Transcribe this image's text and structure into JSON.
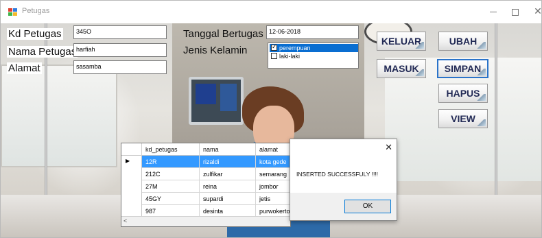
{
  "window": {
    "title": "Petugas",
    "controls": {
      "minimize_icon": "minimize-icon",
      "maximize_icon": "maximize-icon",
      "close_glyph": "✕"
    }
  },
  "form": {
    "kd_petugas": {
      "label": "Kd Petugas",
      "value": "345O"
    },
    "nama_petugas": {
      "label": "Nama Petugas",
      "value": "harfiah"
    },
    "alamat": {
      "label": "Alamat",
      "value": "sasamba"
    },
    "tanggal_bertugas": {
      "label": "Tanggal Bertugas",
      "value": "12-06-2018"
    },
    "jenis_kelamin": {
      "label": "Jenis Kelamin",
      "options": [
        {
          "label": "perempuan",
          "checked": true,
          "selected": true
        },
        {
          "label": "laki-laki",
          "checked": false,
          "selected": false
        }
      ]
    }
  },
  "buttons": {
    "keluar": "KELUAR",
    "ubah": "UBAH",
    "masuk": "MASUK",
    "simpan": "SIMPAN",
    "hapus": "HAPUS",
    "view": "VIEW"
  },
  "grid": {
    "columns": [
      "kd_petugas",
      "nama",
      "alamat"
    ],
    "rows": [
      [
        "12R",
        "rizaldi",
        "kota gede"
      ],
      [
        "212C",
        "zulfikar",
        "semarang"
      ],
      [
        "27M",
        "reina",
        "jombor"
      ],
      [
        "45GY",
        "supardi",
        "jetis"
      ],
      [
        "987",
        "desinta",
        "purwokerto"
      ]
    ],
    "selected_row": 0,
    "row_arrow": "▶",
    "scroll_left_arrow": "<"
  },
  "message_box": {
    "text": "INSERTED SUCCESSFULY !!!!",
    "ok_label": "OK",
    "close_glyph": "✕"
  }
}
